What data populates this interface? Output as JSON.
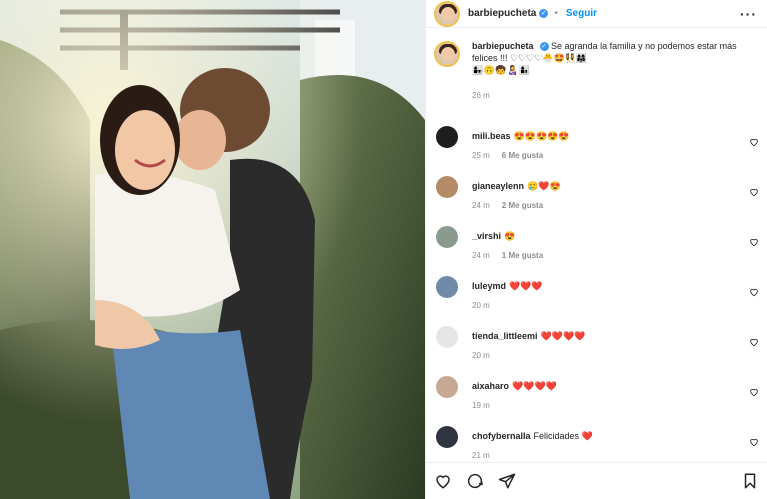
{
  "post": {
    "username": "barbiepucheta",
    "follow_label": "Seguir",
    "caption": "Se agranda la familia y no podemos estar más felices !!! ♡♡♡♡🐣🤩👯‍♀️👩‍👩‍👧",
    "caption_emojis": "👩‍👧🙃🧒👩‍🍼👩‍👦",
    "time": "26 m"
  },
  "comments": [
    {
      "user": "mili.beas",
      "text": "😍😍😍😍😍",
      "time": "25 m",
      "likes": "6 Me gusta"
    },
    {
      "user": "gianeaylenn",
      "text": "🥲❤️😍",
      "time": "24 m",
      "likes": "2 Me gusta"
    },
    {
      "user": "_virshi",
      "text": "😍",
      "time": "24 m",
      "likes": "1 Me gusta"
    },
    {
      "user": "luleymd",
      "text": "❤️❤️❤️",
      "time": "20 m",
      "likes": ""
    },
    {
      "user": "tienda_littleemi",
      "text": "❤️❤️❤️❤️",
      "time": "20 m",
      "likes": ""
    },
    {
      "user": "aixaharo",
      "text": "❤️❤️❤️❤️",
      "time": "19 m",
      "likes": ""
    },
    {
      "user": "chofybernalla",
      "text": "Felicidades ❤️",
      "time": "21 m",
      "likes": ""
    }
  ],
  "icons": {
    "like": "heart-icon",
    "comment": "comment-icon",
    "share": "share-icon",
    "save": "bookmark-icon",
    "more": "more-icon",
    "verified": "verified-badge-icon"
  },
  "colors": {
    "accent": "#0095f6",
    "verified": "#3897f0",
    "heart": "#ed4956"
  }
}
